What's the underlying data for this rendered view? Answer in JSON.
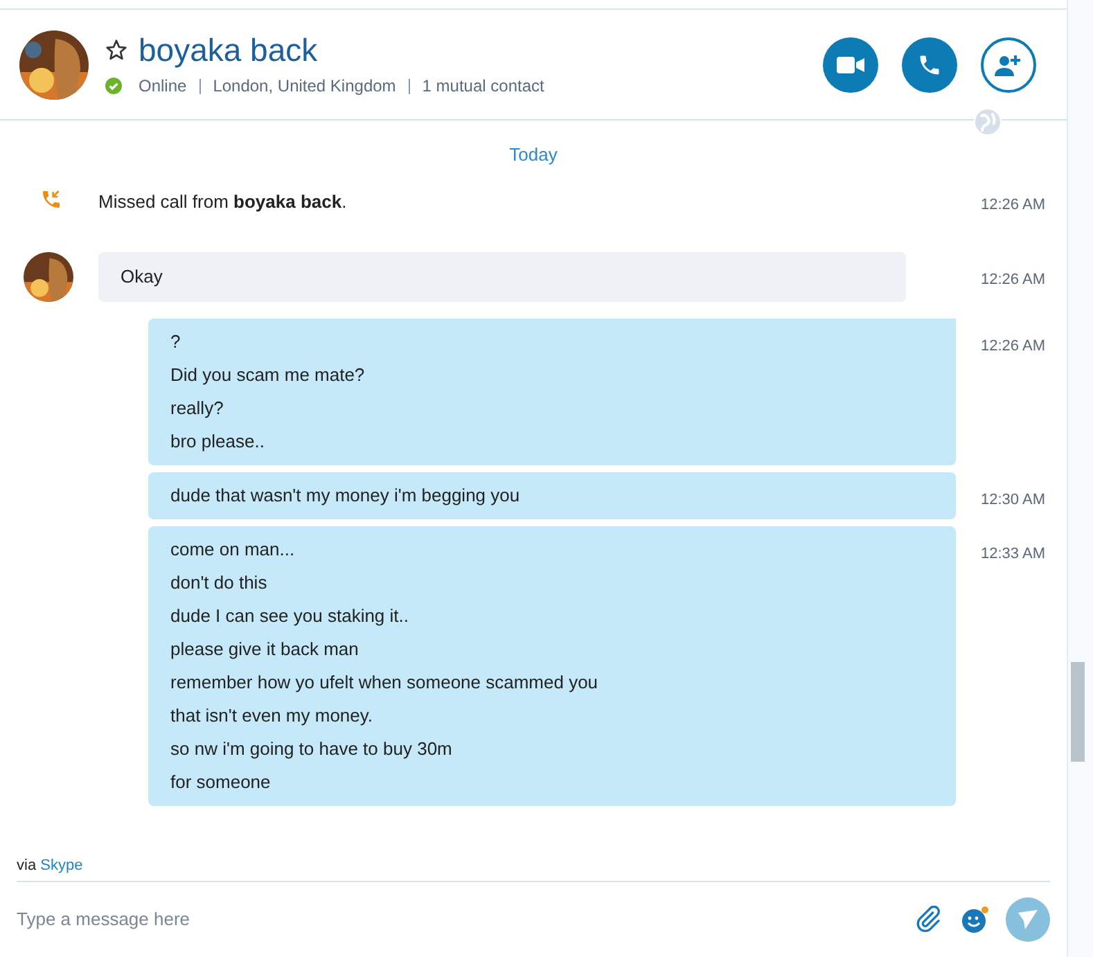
{
  "header": {
    "name": "boyaka back",
    "favorite": false,
    "online": true,
    "status": "Online",
    "location": "London, United Kingdom",
    "mutual": "1 mutual contact"
  },
  "date_divider": "Today",
  "messages": [
    {
      "kind": "call",
      "text": "Missed call from **boyaka back**.",
      "time": "12:26 AM"
    },
    {
      "kind": "incoming",
      "lines": [
        "Okay"
      ],
      "time": "12:26 AM"
    },
    {
      "kind": "outgoing",
      "lines": [
        "?",
        "Did you scam me mate?",
        "really?",
        "bro please.."
      ],
      "time": "12:26 AM"
    },
    {
      "kind": "outgoing",
      "lines": [
        "dude that wasn't my money i'm begging you"
      ],
      "time": "12:30 AM"
    },
    {
      "kind": "outgoing",
      "lines": [
        "come on man...",
        "don't do this",
        "dude I can see you staking it..",
        "please give it back man",
        "remember how yo ufelt when someone scammed you",
        "that isn't even my money.",
        "so nw i'm going to have to buy 30m",
        "for someone"
      ],
      "time": "12:33 AM"
    }
  ],
  "footer": {
    "via": "via",
    "link": "Skype"
  },
  "composer": {
    "placeholder": "Type a message here",
    "emoticon_notification": true
  }
}
